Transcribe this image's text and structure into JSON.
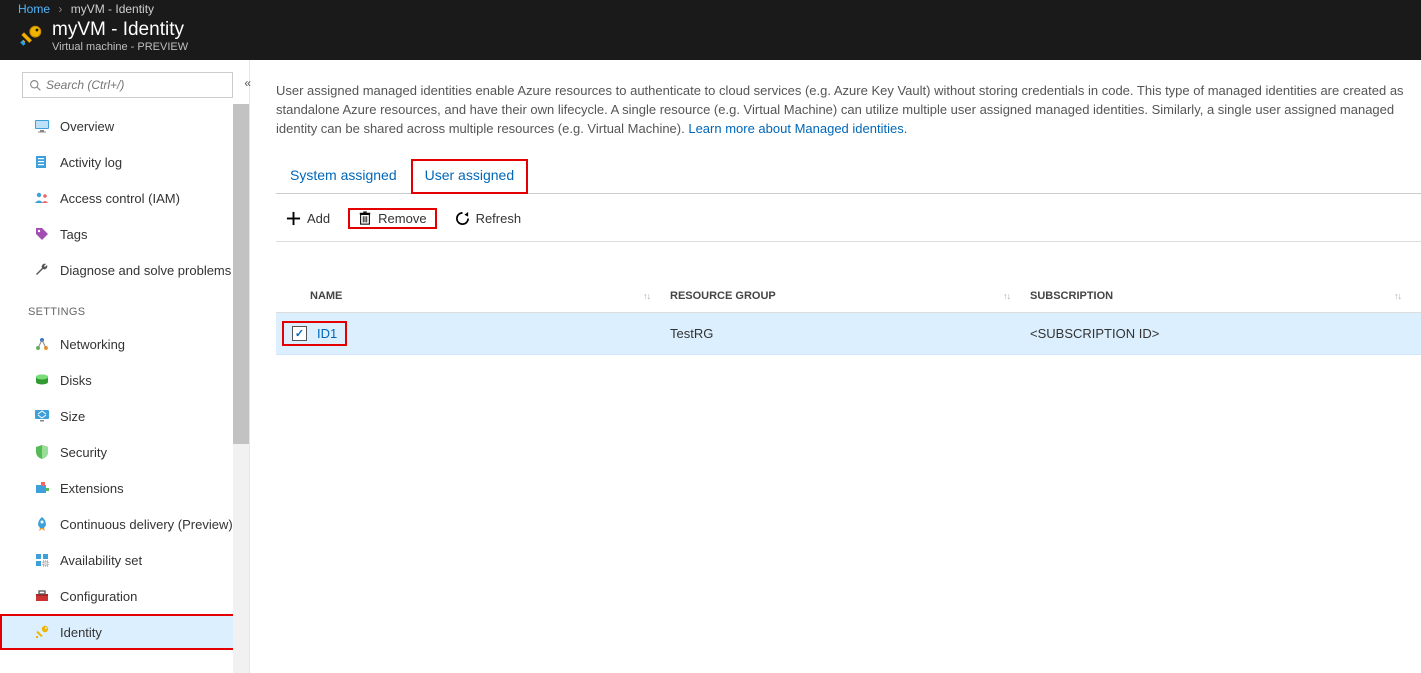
{
  "breadcrumb": {
    "home": "Home",
    "current": "myVM - Identity"
  },
  "page": {
    "title": "myVM - Identity",
    "subtitle": "Virtual machine - PREVIEW"
  },
  "search": {
    "placeholder": "Search (Ctrl+/)"
  },
  "nav": {
    "overview": "Overview",
    "activity_log": "Activity log",
    "access_control": "Access control (IAM)",
    "tags": "Tags",
    "diagnose": "Diagnose and solve problems",
    "section_settings": "SETTINGS",
    "networking": "Networking",
    "disks": "Disks",
    "size": "Size",
    "security": "Security",
    "extensions": "Extensions",
    "continuous_delivery": "Continuous delivery (Preview)",
    "availability_set": "Availability set",
    "configuration": "Configuration",
    "identity": "Identity"
  },
  "description": {
    "text": "User assigned managed identities enable Azure resources to authenticate to cloud services (e.g. Azure Key Vault) without storing credentials in code. This type of managed identities are created as standalone Azure resources, and have their own lifecycle. A single resource (e.g. Virtual Machine) can utilize multiple user assigned managed identities. Similarly, a single user assigned managed identity can be shared across multiple resources (e.g. Virtual Machine). ",
    "link": "Learn more about Managed identities."
  },
  "tabs": {
    "system_assigned": "System assigned",
    "user_assigned": "User assigned"
  },
  "toolbar": {
    "add": "Add",
    "remove": "Remove",
    "refresh": "Refresh"
  },
  "table": {
    "headers": {
      "name": "NAME",
      "resource_group": "RESOURCE GROUP",
      "subscription": "SUBSCRIPTION"
    },
    "rows": [
      {
        "name": "ID1",
        "resource_group": "TestRG",
        "subscription": "<SUBSCRIPTION ID>",
        "checked": true
      }
    ]
  }
}
